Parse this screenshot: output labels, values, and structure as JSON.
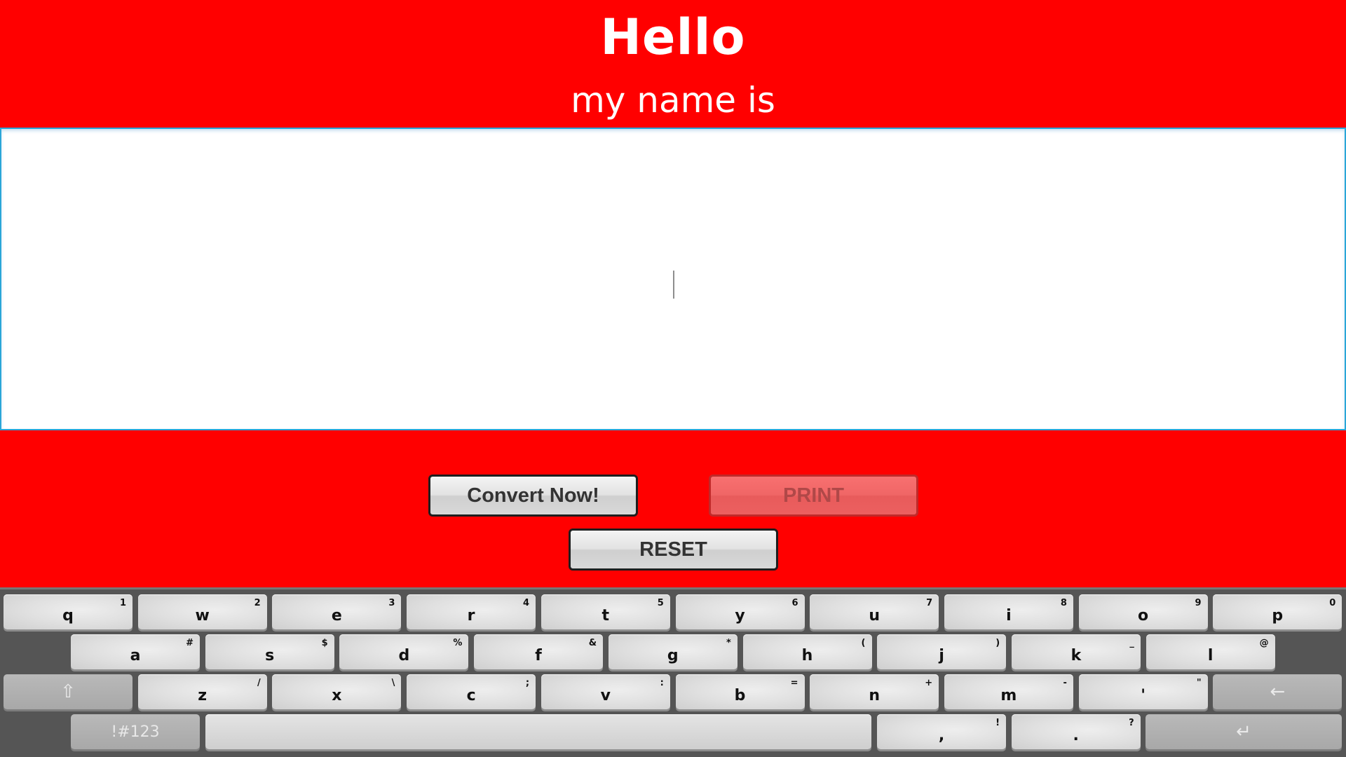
{
  "header": {
    "title": "Hello",
    "subtitle": "my name is"
  },
  "name_input": {
    "value": "",
    "placeholder": ""
  },
  "buttons": {
    "convert": "Convert Now!",
    "print": "PRINT",
    "reset": "RESET"
  },
  "colors": {
    "background": "#ff0000",
    "input_border": "#2aa6d8",
    "print_disabled": "#f06666",
    "keyboard_bg": "#555555"
  },
  "keyboard": {
    "row1": [
      {
        "key": "q",
        "alt": "1"
      },
      {
        "key": "w",
        "alt": "2"
      },
      {
        "key": "e",
        "alt": "3"
      },
      {
        "key": "r",
        "alt": "4"
      },
      {
        "key": "t",
        "alt": "5"
      },
      {
        "key": "y",
        "alt": "6"
      },
      {
        "key": "u",
        "alt": "7"
      },
      {
        "key": "i",
        "alt": "8"
      },
      {
        "key": "o",
        "alt": "9"
      },
      {
        "key": "p",
        "alt": "0"
      }
    ],
    "row2": [
      {
        "key": "a",
        "alt": "#"
      },
      {
        "key": "s",
        "alt": "$"
      },
      {
        "key": "d",
        "alt": "%"
      },
      {
        "key": "f",
        "alt": "&"
      },
      {
        "key": "g",
        "alt": "*"
      },
      {
        "key": "h",
        "alt": "("
      },
      {
        "key": "j",
        "alt": ")"
      },
      {
        "key": "k",
        "alt": "_"
      },
      {
        "key": "l",
        "alt": "@"
      }
    ],
    "row3": [
      {
        "key": "z",
        "alt": "/"
      },
      {
        "key": "x",
        "alt": "\\"
      },
      {
        "key": "c",
        "alt": ";"
      },
      {
        "key": "v",
        "alt": ":"
      },
      {
        "key": "b",
        "alt": "="
      },
      {
        "key": "n",
        "alt": "+"
      },
      {
        "key": "m",
        "alt": "-"
      },
      {
        "key": "'",
        "alt": "\""
      }
    ],
    "row4": [
      {
        "key": ",",
        "alt": "!"
      },
      {
        "key": ".",
        "alt": "?"
      }
    ],
    "shift_icon": "shift-arrow-icon",
    "shift_glyph": "⇧",
    "backspace_icon": "backspace-arrow-icon",
    "backspace_glyph": "←",
    "symbols_label": "!#123",
    "enter_icon": "enter-return-icon",
    "enter_glyph": "↵"
  }
}
